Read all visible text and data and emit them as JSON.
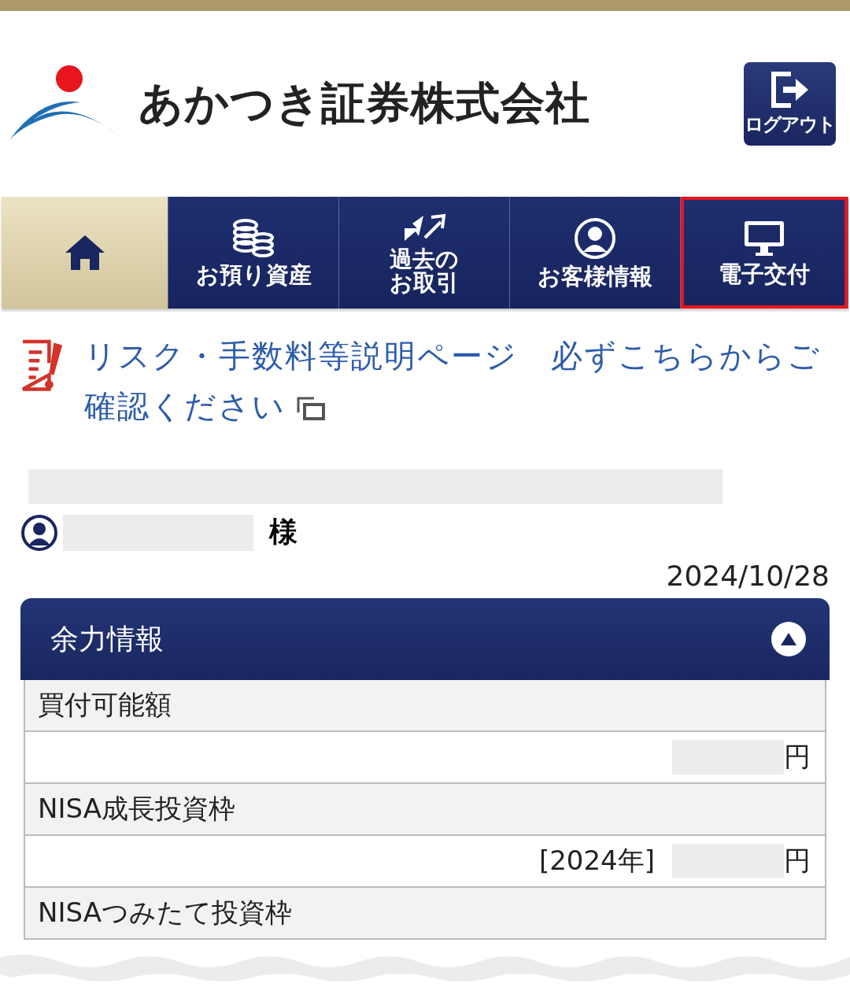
{
  "header": {
    "company": "あかつき証券株式会社",
    "logout": "ログアウト"
  },
  "nav": [
    {
      "selected": true,
      "highlighted": false
    },
    {
      "label": "お預り資産",
      "selected": false,
      "highlighted": false
    },
    {
      "label": "過去のお取引",
      "selected": false,
      "highlighted": false
    },
    {
      "label": "お客様情報",
      "selected": false,
      "highlighted": false
    },
    {
      "label": "電子交付",
      "selected": false,
      "highlighted": true
    }
  ],
  "risk_link": "リスク・手数料等説明ページ　必ずこちらからご確認ください",
  "notice": {
    "redacted": true
  },
  "customer": {
    "redacted": true,
    "suffix": "様"
  },
  "date": "2024/10/28",
  "panel": {
    "title": "余力情報",
    "expanded": true,
    "rows": [
      {
        "label": "買付可能額",
        "redacted": true,
        "unit": "円"
      },
      {
        "label": "NISA成長投資枠",
        "prefix": "[2024年]",
        "redacted": true,
        "unit": "円"
      },
      {
        "label": "NISAつみたて投資枠"
      }
    ]
  }
}
